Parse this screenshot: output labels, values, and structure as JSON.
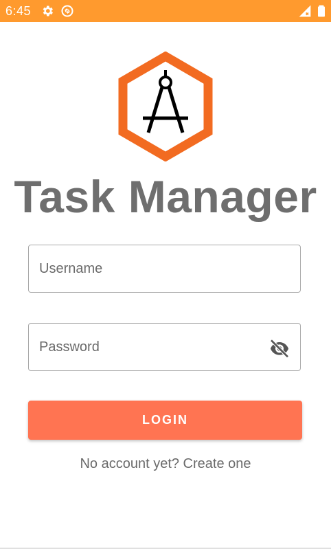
{
  "status_bar": {
    "time": "6:45",
    "icons": [
      "gear-icon",
      "sync-icon",
      "signal-icon",
      "battery-icon"
    ],
    "background": "#FF9A2E"
  },
  "logo": {
    "icon": "compass-icon",
    "hexagon_color": "#F26B21"
  },
  "app": {
    "title": "Task Manager"
  },
  "form": {
    "username": {
      "value": "",
      "placeholder": "Username"
    },
    "password": {
      "value": "",
      "placeholder": "Password",
      "toggle_icon": "eye-off-icon"
    },
    "login_label": "LOGIN",
    "login_color": "#FF7452",
    "signup_text": "No account yet? Create one"
  }
}
